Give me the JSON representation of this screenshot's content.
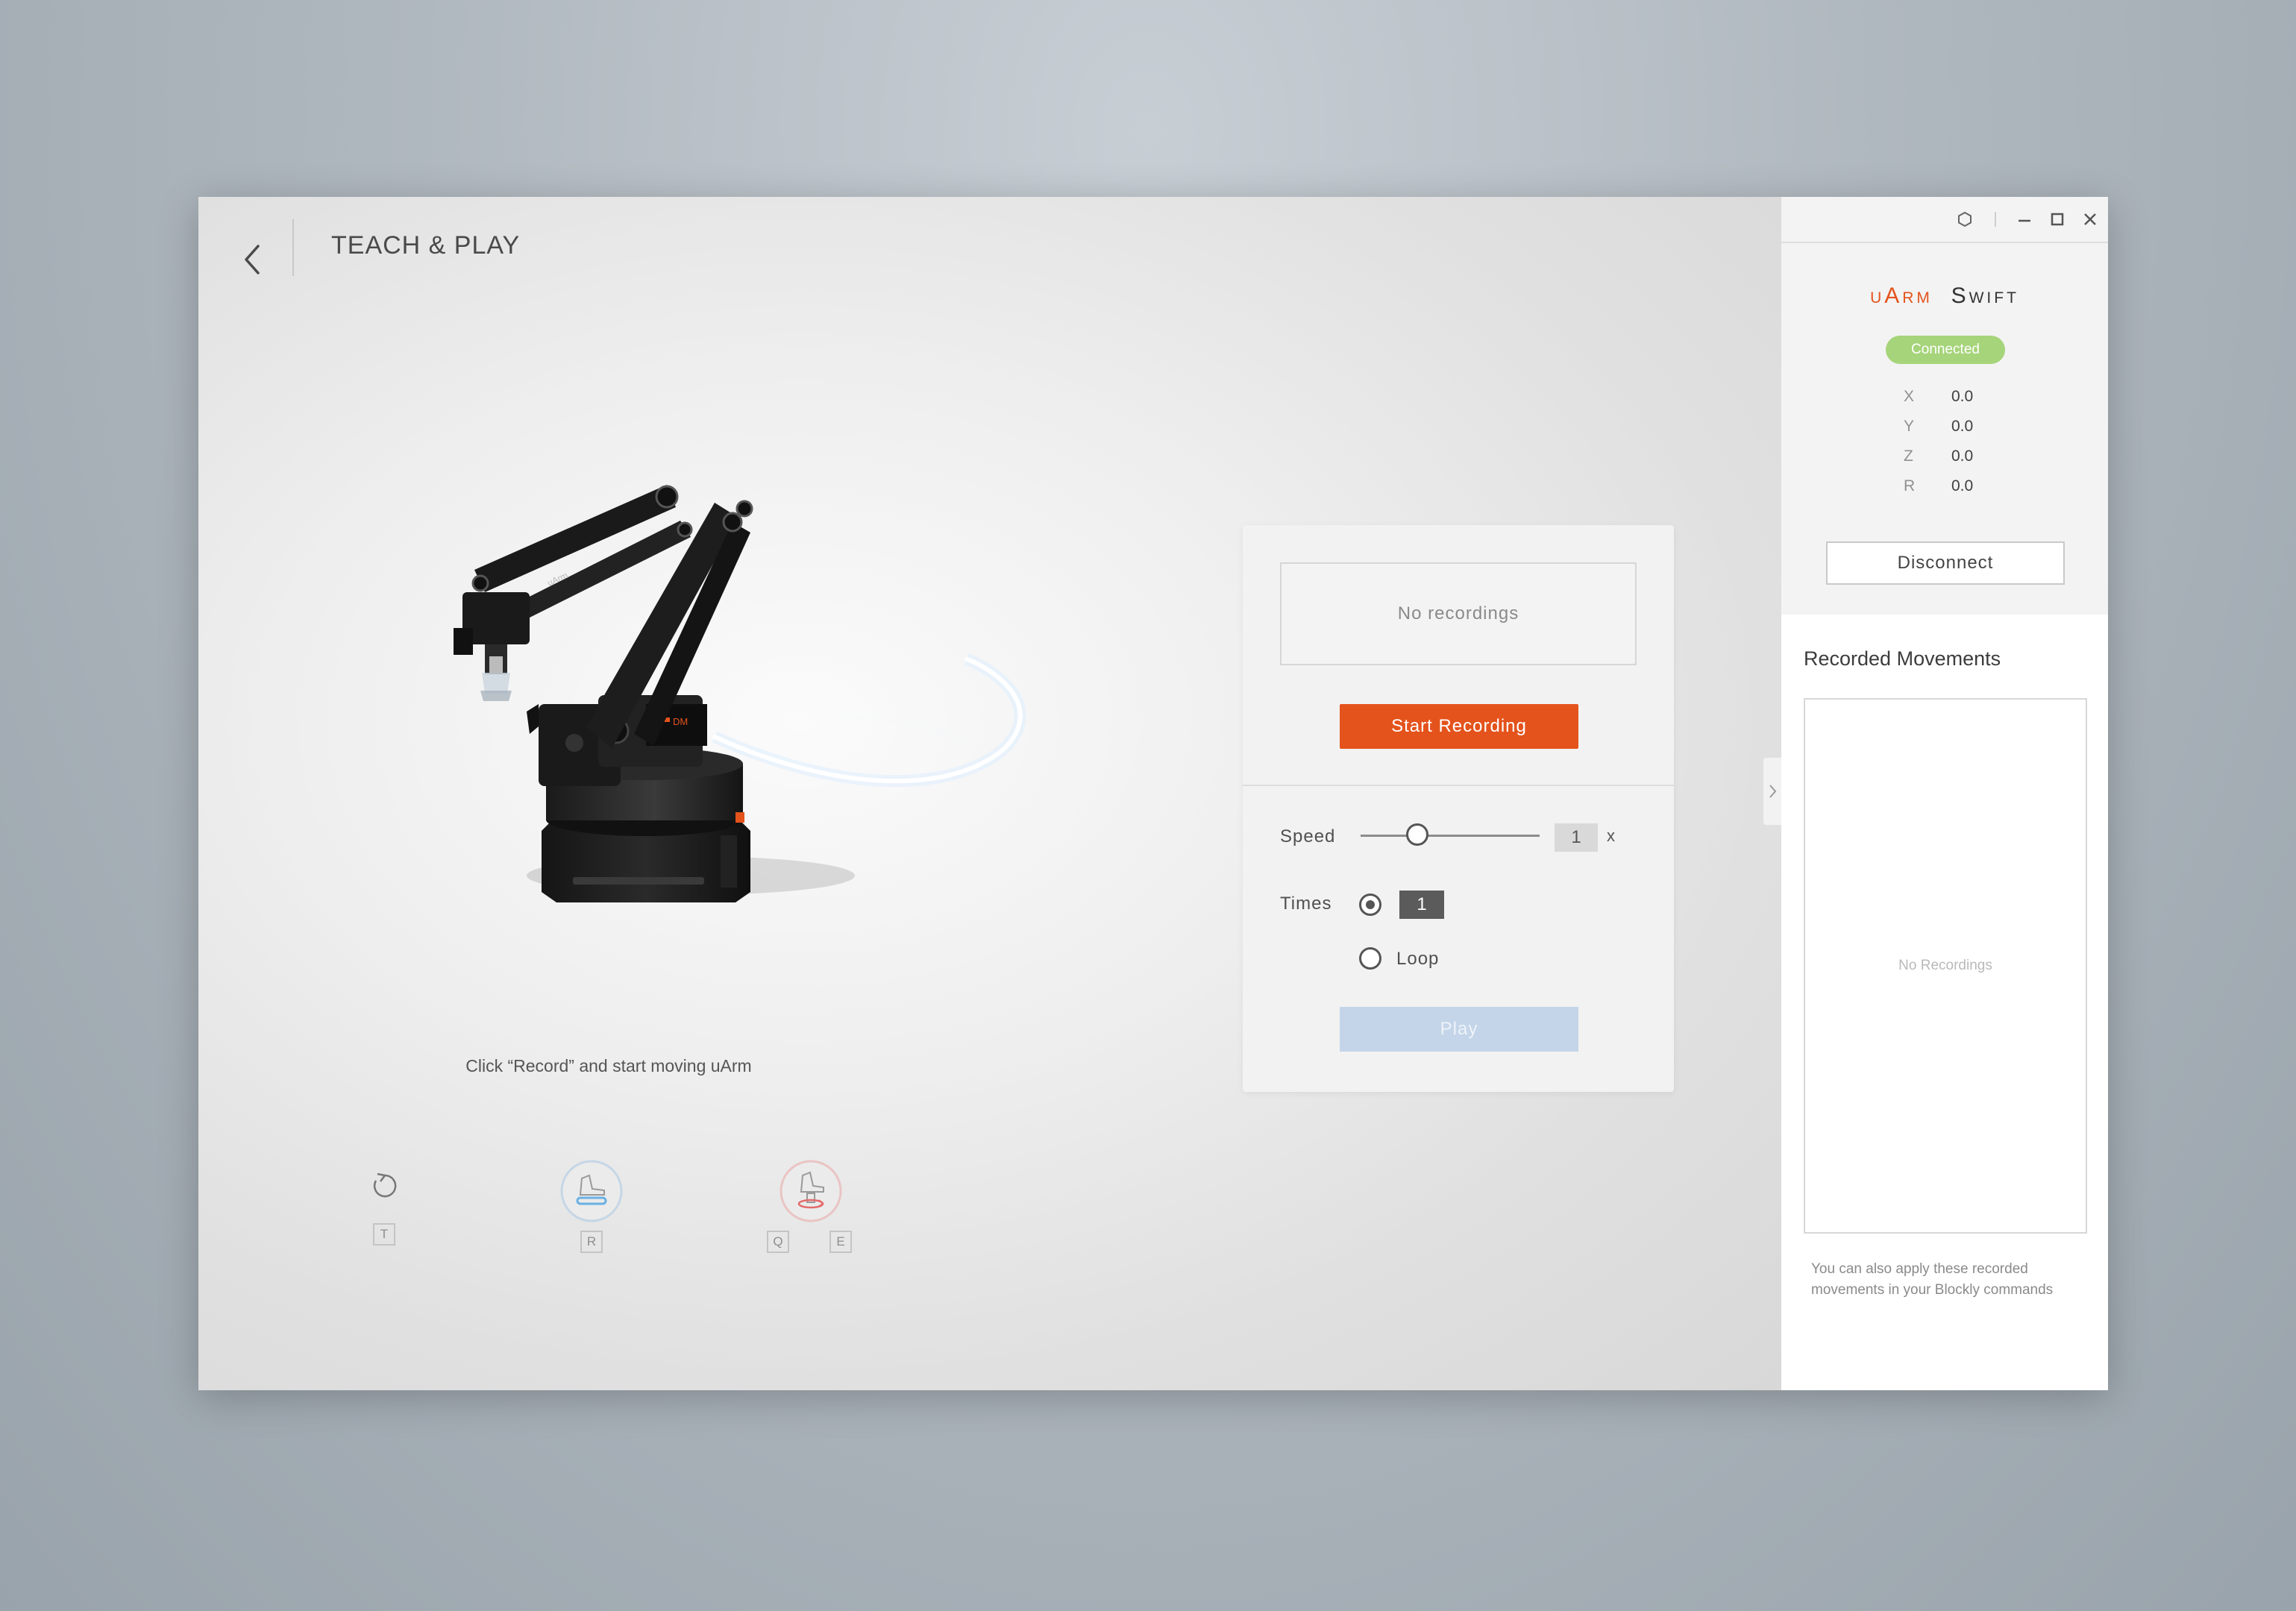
{
  "header": {
    "title": "TEACH & PLAY"
  },
  "main": {
    "hint": "Click “Record” and start moving uArm"
  },
  "tools": [
    {
      "name": "reset",
      "icon": "reset-rotate-icon",
      "keys": [
        "T"
      ]
    },
    {
      "name": "pen-mode",
      "icon": "pen-holder-icon",
      "keys": [
        "R"
      ]
    },
    {
      "name": "rotate-end",
      "icon": "rotate-end-effector-icon",
      "keys": [
        "Q",
        "E"
      ]
    }
  ],
  "recording": {
    "empty_label": "No recordings",
    "start_label": "Start Recording"
  },
  "playback": {
    "speed_label": "Speed",
    "speed_value": "1",
    "speed_unit": "x",
    "speed_slider_fraction": 0.3,
    "times_label": "Times",
    "times_value": "1",
    "loop_label": "Loop",
    "selected_mode": "times",
    "play_label": "Play"
  },
  "sidebar": {
    "brand_a": "uArm",
    "brand_b": "Swift",
    "status": "Connected",
    "coords": [
      {
        "axis": "X",
        "value": "0.0"
      },
      {
        "axis": "Y",
        "value": "0.0"
      },
      {
        "axis": "Z",
        "value": "0.0"
      },
      {
        "axis": "R",
        "value": "0.0"
      }
    ],
    "disconnect_label": "Disconnect",
    "recorded_title": "Recorded Movements",
    "recorded_empty": "No Recordings",
    "footer": "You can also apply these recorded movements in your Blockly commands"
  },
  "colors": {
    "accent": "#e4531c",
    "connected": "#a6d47a",
    "play_disabled": "#c4d5e9"
  }
}
